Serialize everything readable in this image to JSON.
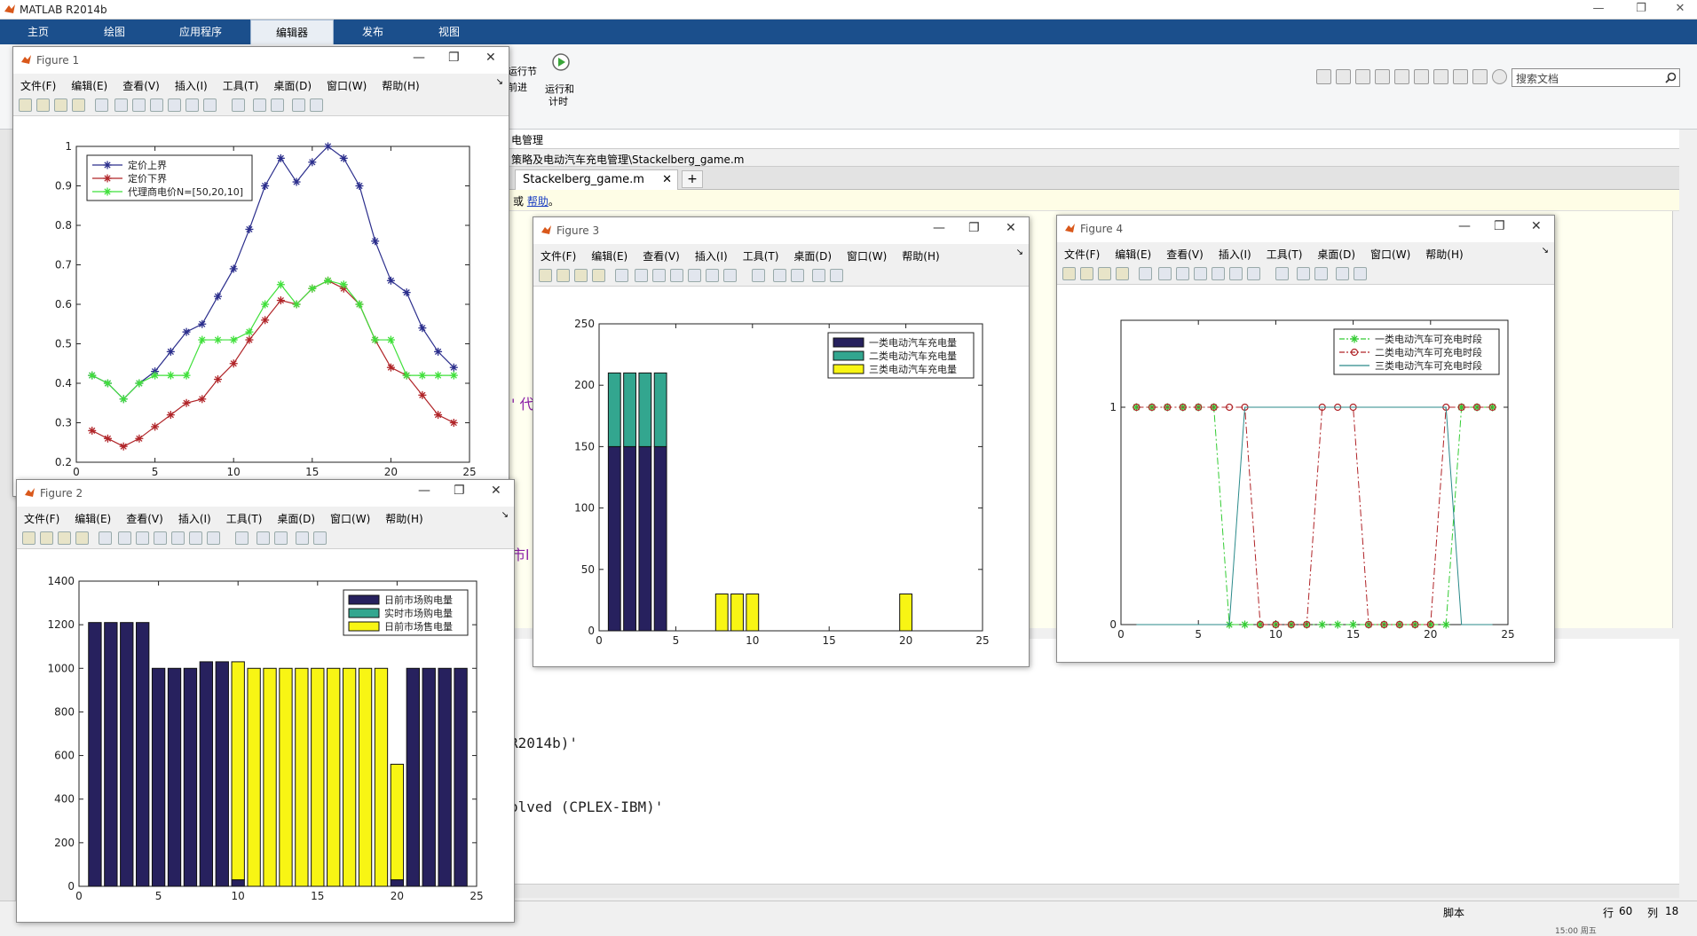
{
  "app": {
    "title": "MATLAB R2014b"
  },
  "window_controls": {
    "minimize": "—",
    "maximize": "❐",
    "close": "✕"
  },
  "ribbon_tabs": [
    "主页",
    "绘图",
    "应用程序",
    "编辑器",
    "发布",
    "视图"
  ],
  "ribbon": {
    "run_section_label": "运行节",
    "advance_label": "前进",
    "run_time_label1": "运行和",
    "run_time_label2": "计时"
  },
  "search": {
    "placeholder": "搜索文档"
  },
  "address": {
    "text": "电管理"
  },
  "path": {
    "text": "策略及电动汽车充电管理\\Stackelberg_game.m"
  },
  "editor": {
    "tab": "Stackelberg_game.m",
    "tab_close": "✕",
    "add_tab": "+",
    "info_prefix": "或",
    "info_link": "帮助",
    "info_suffix": "。",
    "frag1": "' 代",
    "frag2": "市l"
  },
  "command": {
    "line1": "R2014b)'",
    "line2": "olved (CPLEX-IBM)'"
  },
  "status": {
    "mode": "脚本",
    "row_label": "行",
    "row": "60",
    "col_label": "列",
    "col": "18",
    "clock": "15:00 周五"
  },
  "figure_menu": [
    "文件(F)",
    "编辑(E)",
    "查看(V)",
    "插入(I)",
    "工具(T)",
    "桌面(D)",
    "窗口(W)",
    "帮助(H)"
  ],
  "figures": [
    {
      "title": "Figure 1"
    },
    {
      "title": "Figure 2"
    },
    {
      "title": "Figure 3"
    },
    {
      "title": "Figure 4"
    }
  ],
  "colors": {
    "navy": "#27215e",
    "teal": "#33a68f",
    "yellow": "#f8f514",
    "blue_line": "#2b2e8c",
    "red_line": "#b02428",
    "green_line": "#3fe03a",
    "ribbon_blue": "#1b4f8c"
  },
  "chart_data": [
    {
      "type": "line",
      "figure": "Figure 1",
      "x": [
        1,
        2,
        3,
        4,
        5,
        6,
        7,
        8,
        9,
        10,
        11,
        12,
        13,
        14,
        15,
        16,
        17,
        18,
        19,
        20,
        21,
        22,
        23,
        24
      ],
      "xlim": [
        0,
        25
      ],
      "ylim": [
        0.2,
        1
      ],
      "xticks": [
        "0",
        "5",
        "10",
        "15",
        "20",
        "25"
      ],
      "yticks": [
        "0.2",
        "0.3",
        "0.4",
        "0.5",
        "0.6",
        "0.7",
        "0.8",
        "0.9",
        "1"
      ],
      "legend": "top-left",
      "series": [
        {
          "name": "定价上界",
          "color": "#2b2e8c",
          "values": [
            0.42,
            0.4,
            0.36,
            0.4,
            0.43,
            0.48,
            0.53,
            0.55,
            0.62,
            0.69,
            0.79,
            0.9,
            0.97,
            0.91,
            0.96,
            1.0,
            0.97,
            0.9,
            0.76,
            0.66,
            0.63,
            0.54,
            0.48,
            0.44
          ]
        },
        {
          "name": "定价下界",
          "color": "#b02428",
          "values": [
            0.28,
            0.26,
            0.24,
            0.26,
            0.29,
            0.32,
            0.35,
            0.36,
            0.41,
            0.45,
            0.51,
            0.56,
            0.61,
            0.6,
            0.64,
            0.66,
            0.64,
            0.6,
            0.51,
            0.44,
            0.42,
            0.37,
            0.32,
            0.3
          ]
        },
        {
          "name": "代理商电价N=[50,20,10]",
          "color": "#3fe03a",
          "values": [
            0.42,
            0.4,
            0.36,
            0.4,
            0.42,
            0.42,
            0.42,
            0.51,
            0.51,
            0.51,
            0.53,
            0.6,
            0.65,
            0.6,
            0.64,
            0.66,
            0.65,
            0.6,
            0.51,
            0.51,
            0.42,
            0.42,
            0.42,
            0.42
          ]
        }
      ]
    },
    {
      "type": "bar",
      "figure": "Figure 2",
      "stacked": true,
      "categories": [
        1,
        2,
        3,
        4,
        5,
        6,
        7,
        8,
        9,
        10,
        11,
        12,
        13,
        14,
        15,
        16,
        17,
        18,
        19,
        20,
        21,
        22,
        23,
        24
      ],
      "xlim": [
        0,
        25
      ],
      "ylim": [
        0,
        1400
      ],
      "xticks": [
        "0",
        "5",
        "10",
        "15",
        "20",
        "25"
      ],
      "yticks": [
        "0",
        "200",
        "400",
        "600",
        "800",
        "1000",
        "1200",
        "1400"
      ],
      "legend": "top-right",
      "series": [
        {
          "name": "日前市场购电量",
          "color": "#27215e",
          "values": [
            1210,
            1210,
            1210,
            1210,
            1000,
            1000,
            1000,
            1030,
            1030,
            30,
            0,
            0,
            0,
            0,
            0,
            0,
            0,
            0,
            0,
            30,
            1000,
            1000,
            1000,
            1000
          ]
        },
        {
          "name": "实时市场购电量",
          "color": "#33a68f",
          "values": [
            0,
            0,
            0,
            0,
            0,
            0,
            0,
            0,
            0,
            0,
            0,
            0,
            0,
            0,
            0,
            0,
            0,
            0,
            0,
            0,
            0,
            0,
            0,
            0
          ]
        },
        {
          "name": "日前市场售电量",
          "color": "#f8f514",
          "values": [
            0,
            0,
            0,
            0,
            0,
            0,
            0,
            0,
            0,
            1000,
            1000,
            1000,
            1000,
            1000,
            1000,
            1000,
            1000,
            1000,
            1000,
            530,
            0,
            0,
            0,
            0
          ]
        }
      ]
    },
    {
      "type": "bar",
      "figure": "Figure 3",
      "stacked": true,
      "categories": [
        1,
        2,
        3,
        4,
        5,
        6,
        7,
        8,
        9,
        10,
        11,
        12,
        13,
        14,
        15,
        16,
        17,
        18,
        19,
        20,
        21,
        22,
        23,
        24
      ],
      "xlim": [
        0,
        25
      ],
      "ylim": [
        0,
        250
      ],
      "xticks": [
        "0",
        "5",
        "10",
        "15",
        "20",
        "25"
      ],
      "yticks": [
        "0",
        "50",
        "100",
        "150",
        "200",
        "250"
      ],
      "legend": "top-right",
      "series": [
        {
          "name": "一类电动汽车充电量",
          "color": "#27215e",
          "values": [
            150,
            150,
            150,
            150,
            0,
            0,
            0,
            0,
            0,
            0,
            0,
            0,
            0,
            0,
            0,
            0,
            0,
            0,
            0,
            0,
            0,
            0,
            0,
            0
          ]
        },
        {
          "name": "二类电动汽车充电量",
          "color": "#33a68f",
          "values": [
            60,
            60,
            60,
            60,
            0,
            0,
            0,
            0,
            0,
            0,
            0,
            0,
            0,
            0,
            0,
            0,
            0,
            0,
            0,
            0,
            0,
            0,
            0,
            0
          ]
        },
        {
          "name": "三类电动汽车充电量",
          "color": "#f8f514",
          "values": [
            0,
            0,
            0,
            0,
            0,
            0,
            0,
            30,
            30,
            30,
            0,
            0,
            0,
            0,
            0,
            0,
            0,
            0,
            0,
            30,
            0,
            0,
            0,
            0
          ]
        }
      ]
    },
    {
      "type": "line",
      "figure": "Figure 4",
      "x": [
        1,
        2,
        3,
        4,
        5,
        6,
        7,
        8,
        9,
        10,
        11,
        12,
        13,
        14,
        15,
        16,
        17,
        18,
        19,
        20,
        21,
        22,
        23,
        24
      ],
      "xlim": [
        0,
        25
      ],
      "ylim": [
        0,
        1.4
      ],
      "xticks": [
        "0",
        "5",
        "10",
        "15",
        "20",
        "25"
      ],
      "yticks": [
        "0",
        "1"
      ],
      "legend": "top-right",
      "series": [
        {
          "name": "一类电动汽车可充电时段",
          "color": "#33cc33",
          "style": "dashdot-star",
          "values": [
            1,
            1,
            1,
            1,
            1,
            1,
            0,
            0,
            0,
            0,
            0,
            0,
            0,
            0,
            0,
            0,
            0,
            0,
            0,
            0,
            0,
            1,
            1,
            1
          ]
        },
        {
          "name": "二类电动汽车可充电时段",
          "color": "#b02428",
          "style": "dashdot-circle",
          "values": [
            1,
            1,
            1,
            1,
            1,
            1,
            1,
            1,
            0,
            0,
            0,
            0,
            1,
            1,
            1,
            0,
            0,
            0,
            0,
            0,
            1,
            1,
            1,
            1
          ]
        },
        {
          "name": "三类电动汽车可充电时段",
          "color": "#2a8a8a",
          "style": "solid",
          "values": [
            0,
            0,
            0,
            0,
            0,
            0,
            0,
            1,
            1,
            1,
            1,
            1,
            1,
            1,
            1,
            1,
            1,
            1,
            1,
            1,
            1,
            0,
            0,
            0
          ]
        }
      ]
    }
  ]
}
